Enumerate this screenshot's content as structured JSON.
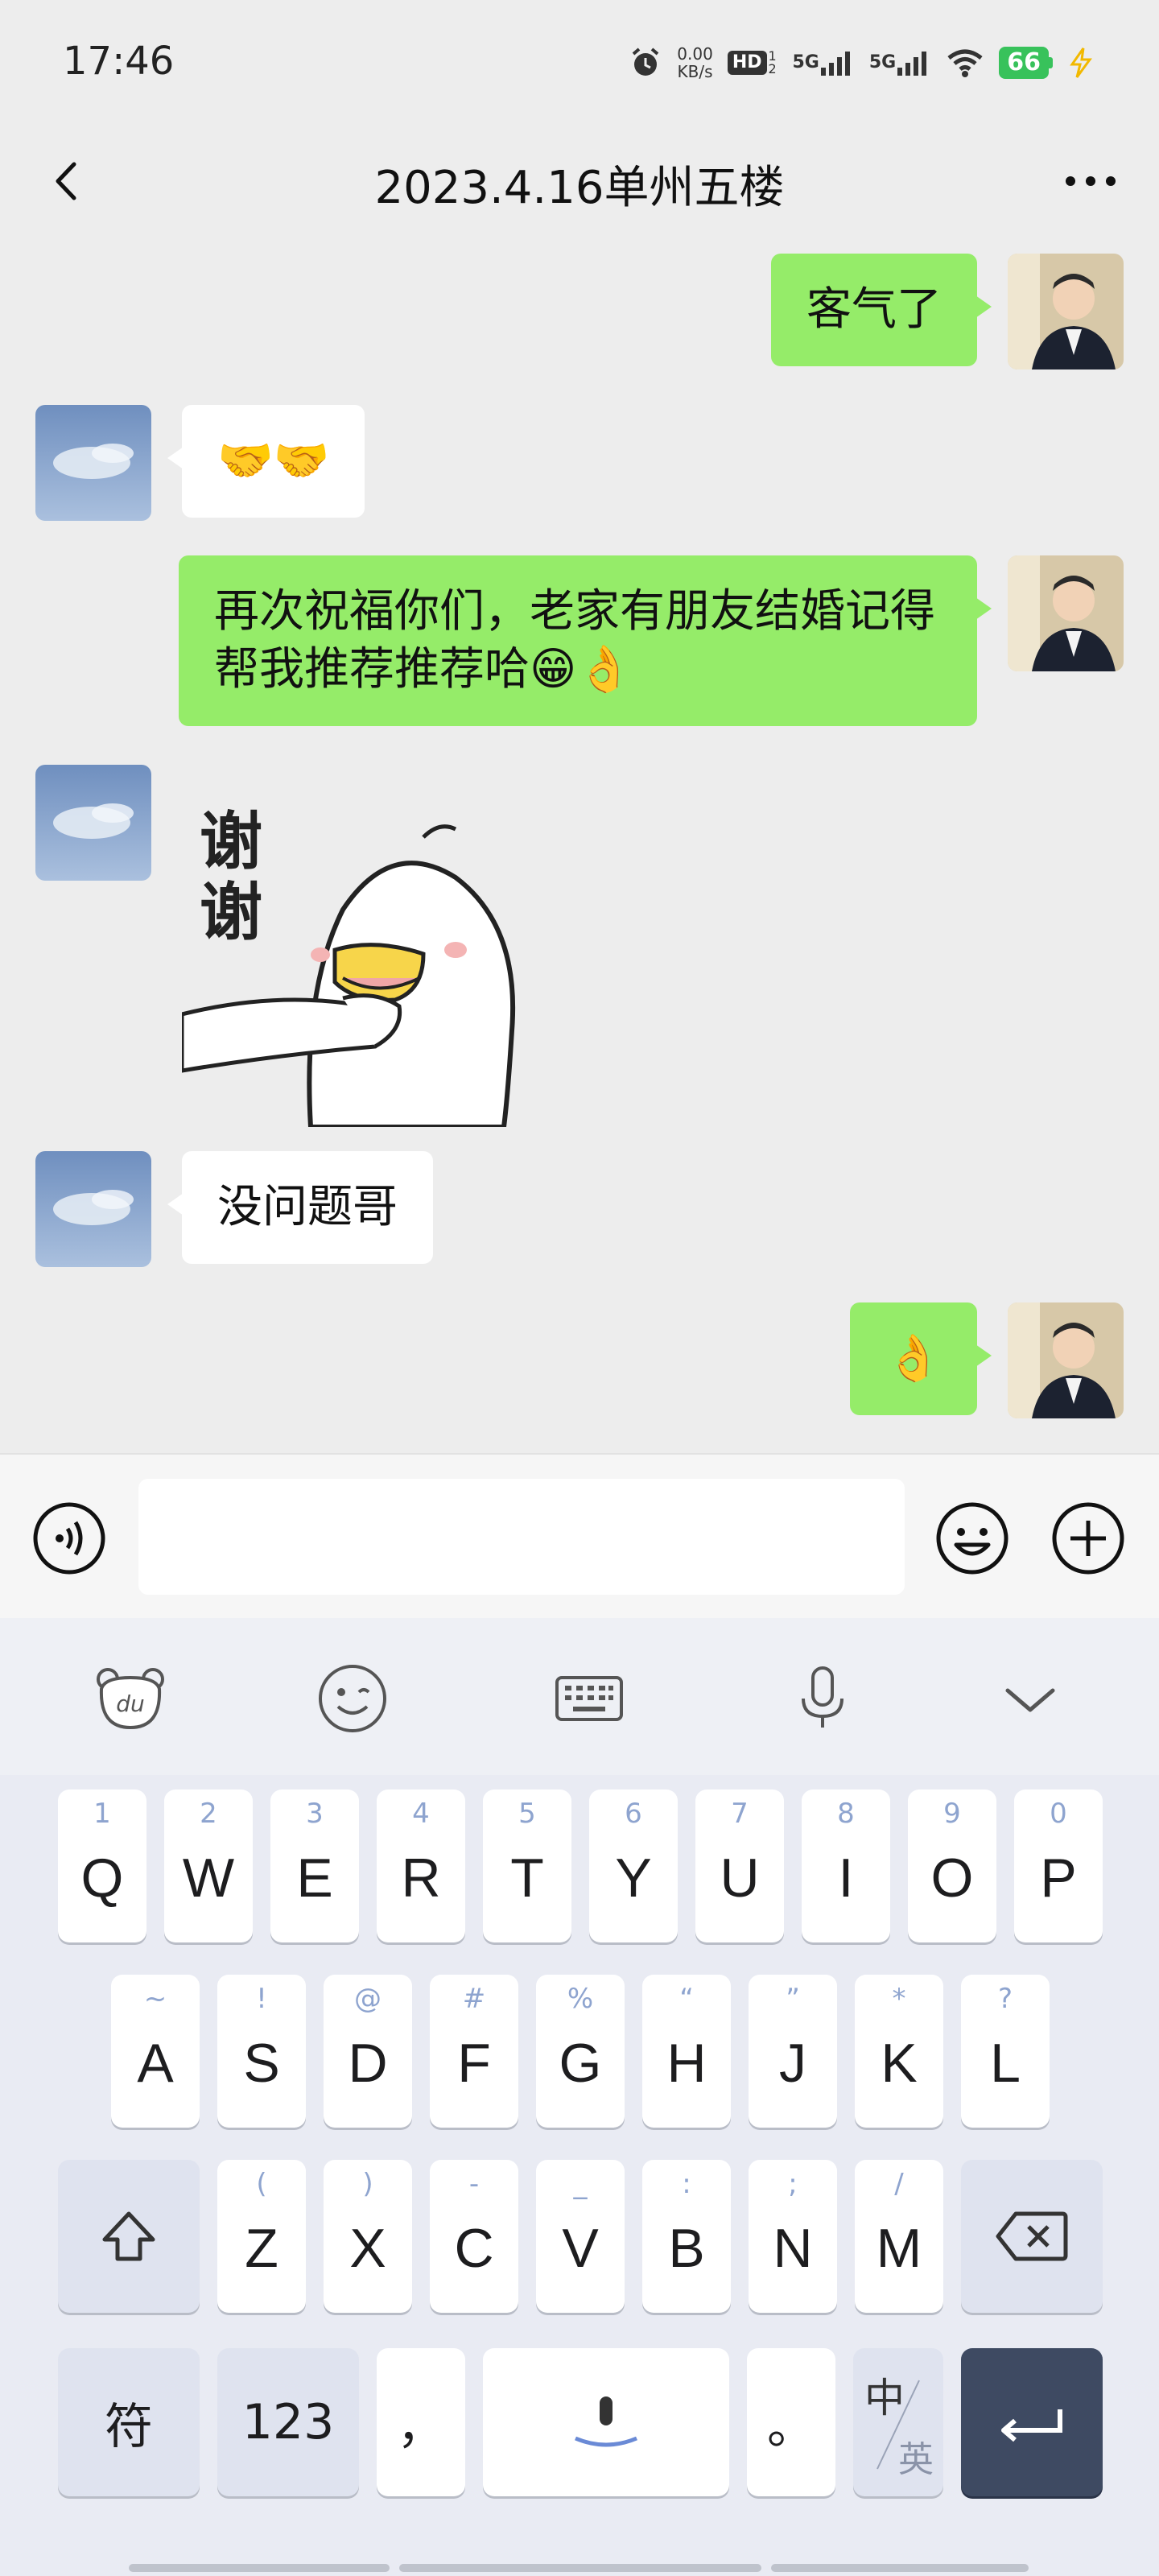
{
  "status": {
    "time": "17:46",
    "net_speed_value": "0.00",
    "net_speed_unit": "KB/s",
    "hd_label": "HD",
    "hd_sub": "1 2",
    "sig1_label": "5G",
    "sig2_label": "5G",
    "battery": "66"
  },
  "nav": {
    "title": "2023.4.16单州五楼"
  },
  "messages": [
    {
      "side": "right",
      "type": "text",
      "text": "客气了"
    },
    {
      "side": "left",
      "type": "text",
      "text": "🤝🤝"
    },
    {
      "side": "right",
      "type": "text",
      "text": "再次祝福你们，老家有朋友结婚记得帮我推荐推荐哈😁👌"
    },
    {
      "side": "left",
      "type": "sticker",
      "text": "谢谢"
    },
    {
      "side": "left",
      "type": "text",
      "text": "没问题哥"
    },
    {
      "side": "right",
      "type": "text",
      "text": "👌"
    }
  ],
  "input": {
    "placeholder": ""
  },
  "keyboard": {
    "row1": [
      {
        "main": "Q",
        "sub": "1"
      },
      {
        "main": "W",
        "sub": "2"
      },
      {
        "main": "E",
        "sub": "3"
      },
      {
        "main": "R",
        "sub": "4"
      },
      {
        "main": "T",
        "sub": "5"
      },
      {
        "main": "Y",
        "sub": "6"
      },
      {
        "main": "U",
        "sub": "7"
      },
      {
        "main": "I",
        "sub": "8"
      },
      {
        "main": "O",
        "sub": "9"
      },
      {
        "main": "P",
        "sub": "0"
      }
    ],
    "row2": [
      {
        "main": "A",
        "sub": "~"
      },
      {
        "main": "S",
        "sub": "!"
      },
      {
        "main": "D",
        "sub": "@"
      },
      {
        "main": "F",
        "sub": "#"
      },
      {
        "main": "G",
        "sub": "%"
      },
      {
        "main": "H",
        "sub": "“"
      },
      {
        "main": "J",
        "sub": "”"
      },
      {
        "main": "K",
        "sub": "*"
      },
      {
        "main": "L",
        "sub": "?"
      }
    ],
    "row3": [
      {
        "main": "Z",
        "sub": "("
      },
      {
        "main": "X",
        "sub": ")"
      },
      {
        "main": "C",
        "sub": "-"
      },
      {
        "main": "V",
        "sub": "_"
      },
      {
        "main": "B",
        "sub": ":"
      },
      {
        "main": "N",
        "sub": ";"
      },
      {
        "main": "M",
        "sub": "/"
      }
    ],
    "symbols_label": "符",
    "numbers_label": "123",
    "comma_label": "，",
    "period_label": "。",
    "lang_zh": "中",
    "lang_en": "英"
  },
  "colors": {
    "bg": "#ededed",
    "bubble_green": "#95ec69",
    "bubble_white": "#ffffff",
    "battery_green": "#38c25b",
    "enter_key": "#3e4a62",
    "hint_blue": "#8ea4cf"
  },
  "icons": {
    "back": "chevron-left-icon",
    "more": "more-horizontal-icon",
    "voice": "voice-icon",
    "emoji": "emoji-icon",
    "plus": "plus-icon",
    "toolbar": [
      "du-bear-icon",
      "smiley-icon",
      "keyboard-icon",
      "microphone-icon",
      "chevron-down-icon"
    ],
    "shift": "shift-icon",
    "backspace": "backspace-icon",
    "space": "mic-space-icon",
    "enter": "enter-icon"
  }
}
